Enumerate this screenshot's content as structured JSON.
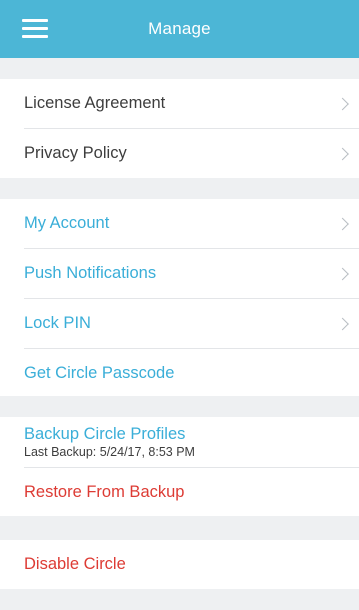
{
  "header": {
    "title": "Manage",
    "menu_icon": "hamburger-icon"
  },
  "colors": {
    "header_bg": "#4cb6d6",
    "accent_blue": "#3aaed8",
    "danger_red": "#dd3b34"
  },
  "section_legal": {
    "items": [
      {
        "label": "License Agreement"
      },
      {
        "label": "Privacy Policy"
      }
    ]
  },
  "section_account": {
    "items": [
      {
        "label": "My Account"
      },
      {
        "label": "Push Notifications"
      },
      {
        "label": "Lock PIN"
      },
      {
        "label": "Get Circle Passcode"
      }
    ]
  },
  "section_backup": {
    "backup_label": "Backup Circle Profiles",
    "last_backup": "Last Backup: 5/24/17, 8:53 PM",
    "restore_label": "Restore From Backup"
  },
  "section_disable": {
    "label": "Disable Circle"
  }
}
